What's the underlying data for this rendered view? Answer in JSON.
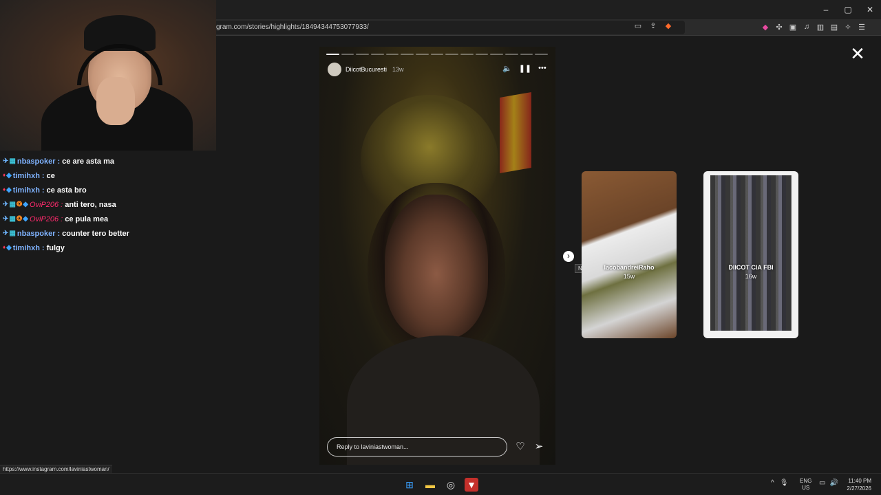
{
  "browser": {
    "url": "gram.com/stories/highlights/18494344753077933/",
    "window_controls": {
      "minimize": "–",
      "restore": "▢",
      "close": "✕"
    }
  },
  "story": {
    "username": "DiicotBucuresti",
    "age": "13w",
    "reply_placeholder": "Reply to laviniastwoman...",
    "progress_segments": 15,
    "progress_done": 1
  },
  "next_tooltip": "Next",
  "thumbnails": [
    {
      "name": "IacobandreiRaho",
      "age": "15w"
    },
    {
      "name": "DIICOT CIA FBI",
      "age": "16w"
    }
  ],
  "chat": [
    {
      "badges": [
        "sword",
        "sub"
      ],
      "user": "nbaspoker",
      "user_color": "blue",
      "text": "ce are asta ma"
    },
    {
      "badges": [
        "pin",
        "cube"
      ],
      "user": "timihxh",
      "user_color": "blue",
      "text": "ce"
    },
    {
      "badges": [
        "pin",
        "cube"
      ],
      "user": "timihxh",
      "user_color": "blue",
      "text": "ce asta bro"
    },
    {
      "badges": [
        "sword",
        "sub",
        "ball",
        "cube"
      ],
      "user": "OviP206",
      "user_color": "pink",
      "text": "anti tero, nasa"
    },
    {
      "badges": [
        "sword",
        "sub",
        "ball",
        "cube"
      ],
      "user": "OviP206",
      "user_color": "pink",
      "text": "ce pula mea"
    },
    {
      "badges": [
        "sword",
        "sub"
      ],
      "user": "nbaspoker",
      "user_color": "blue",
      "text": "counter tero better"
    },
    {
      "badges": [
        "pin",
        "cube"
      ],
      "user": "timihxh",
      "user_color": "blue",
      "text": "fulgy"
    }
  ],
  "status_link": "https://www.instagram.com/laviniastwoman/",
  "taskbar": {
    "lang_top": "ENG",
    "lang_bottom": "US",
    "time": "11:40 PM",
    "date": "2/27/2026"
  },
  "colors": {
    "user_blue": "#7fb3ff",
    "user_pink": "#ff2a6d",
    "brave": "#c4302b"
  }
}
